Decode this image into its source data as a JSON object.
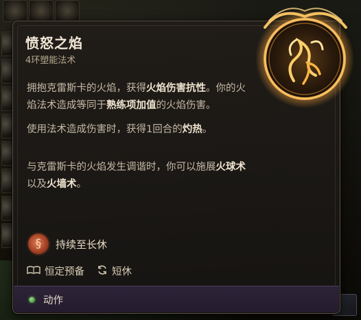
{
  "spell": {
    "title": "愤怒之焰",
    "subtitle": "4环塑能法术",
    "description": [
      [
        {
          "text": "拥抱克雷斯卡的火焰，获得",
          "hl": false
        },
        {
          "text": "火焰伤害抗性",
          "hl": true
        },
        {
          "text": "。你的火焰法术造成等同于",
          "hl": false
        },
        {
          "text": "熟练项加值",
          "hl": true
        },
        {
          "text": "的火焰伤害。",
          "hl": false
        }
      ],
      [
        {
          "text": "使用法术造成伤害时，获得1回合的",
          "hl": false
        },
        {
          "text": "灼热",
          "hl": true
        },
        {
          "text": "。",
          "hl": false
        }
      ],
      [
        {
          "text": "与克雷斯卡的火焰发生调谐时，你可以施展",
          "hl": false
        },
        {
          "text": "火球术",
          "hl": true
        },
        {
          "text": "以及",
          "hl": false
        },
        {
          "text": "火墙术",
          "hl": true
        },
        {
          "text": "。",
          "hl": false
        }
      ]
    ],
    "duration": {
      "label": "持续至长休",
      "icon": "flame-swirl-icon"
    },
    "meta": [
      {
        "label": "恒定预备",
        "icon": "book-icon"
      },
      {
        "label": "短休",
        "icon": "refresh-icon"
      }
    ],
    "action": {
      "label": "动作",
      "icon": "action-dot-icon"
    }
  },
  "colors": {
    "accent": "#e89a3c",
    "panel": "#201c18",
    "action_bar": "#2d2338",
    "highlight_text": "#efe3cf"
  }
}
